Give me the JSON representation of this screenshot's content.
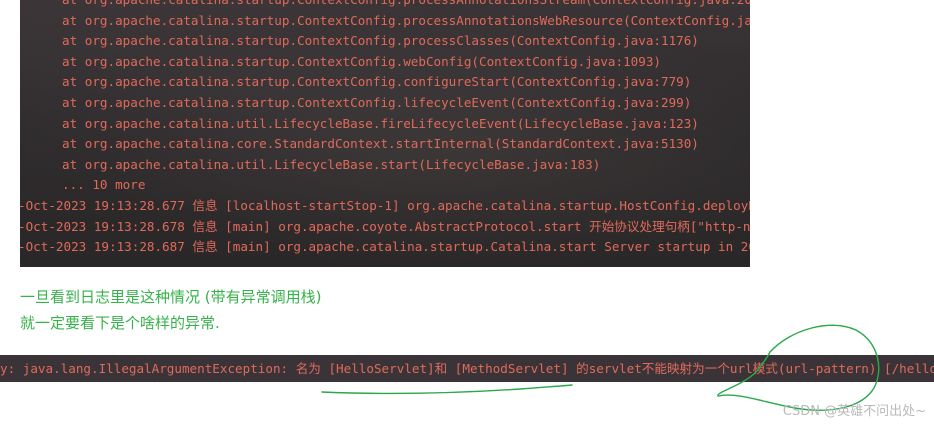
{
  "console": {
    "lines": [
      {
        "text": "at org.apache.catalina.startup.ContextConfig.processAnnotationsStream(ContextConfig.java:201",
        "indent": true
      },
      {
        "text": "at org.apache.catalina.startup.ContextConfig.processAnnotationsWebResource(ContextConfig.java",
        "indent": true
      },
      {
        "text": "at org.apache.catalina.startup.ContextConfig.processClasses(ContextConfig.java:1176)",
        "indent": true
      },
      {
        "text": "at org.apache.catalina.startup.ContextConfig.webConfig(ContextConfig.java:1093)",
        "indent": true
      },
      {
        "text": "at org.apache.catalina.startup.ContextConfig.configureStart(ContextConfig.java:779)",
        "indent": true
      },
      {
        "text": "at org.apache.catalina.startup.ContextConfig.lifecycleEvent(ContextConfig.java:299)",
        "indent": true
      },
      {
        "text": "at org.apache.catalina.util.LifecycleBase.fireLifecycleEvent(LifecycleBase.java:123)",
        "indent": true
      },
      {
        "text": "at org.apache.catalina.core.StandardContext.startInternal(StandardContext.java:5130)",
        "indent": true
      },
      {
        "text": "at org.apache.catalina.util.LifecycleBase.start(LifecycleBase.java:183)",
        "indent": true
      },
      {
        "text": "... 10 more",
        "indent": true
      },
      {
        "text": "-Oct-2023 19:13:28.677 信息 [localhost-startStop-1] org.apache.catalina.startup.HostConfig.deployDe",
        "indent": false
      },
      {
        "text": "-Oct-2023 19:13:28.678 信息 [main] org.apache.coyote.AbstractProtocol.start 开始协议处理句柄[\"http-n",
        "indent": false
      },
      {
        "text": "-Oct-2023 19:13:28.687 信息 [main] org.apache.catalina.startup.Catalina.start Server startup in 200",
        "indent": false
      }
    ]
  },
  "notes": {
    "line1": "一旦看到日志里是这种情况 (带有异常调用栈)",
    "line2": "就一定要看下是个啥样的异常."
  },
  "strip": {
    "text": "y: java.lang.IllegalArgumentException: 名为 [HelloServlet]和 [MethodServlet] 的servlet不能映射为一个url模式(url-pattern) [/hello"
  },
  "watermark": "CSDN @英雄不问出处~",
  "colors": {
    "log_text": "#e06a5a",
    "note_text": "#36b24a",
    "scribble": "#2aa84a",
    "console_bg": "#2e2b2d"
  }
}
